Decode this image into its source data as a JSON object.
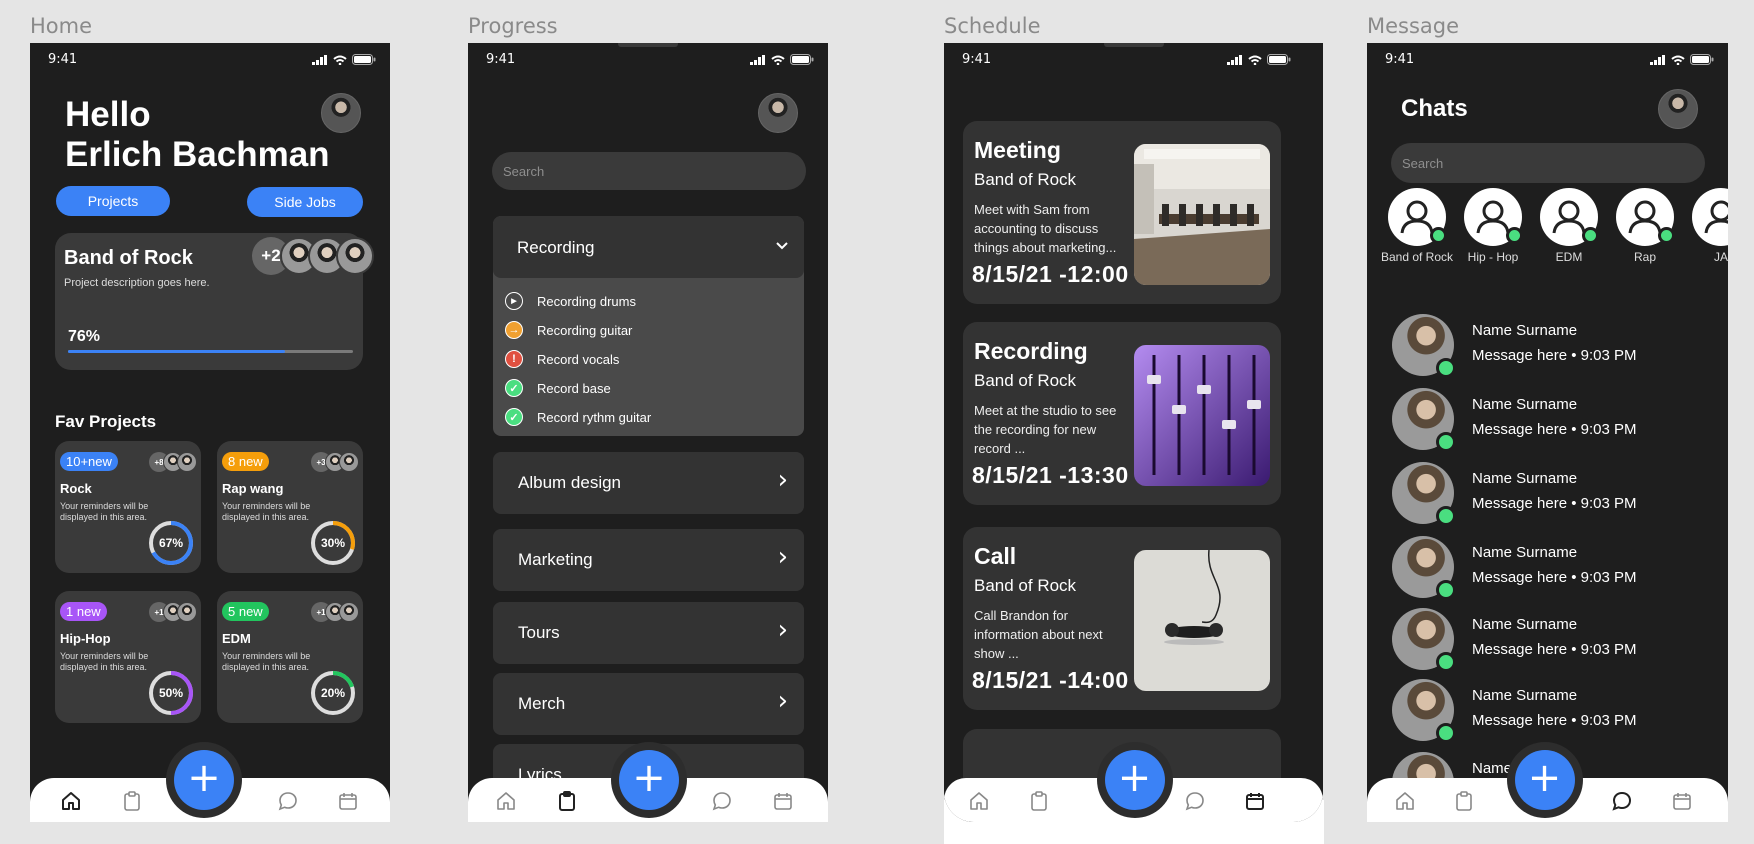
{
  "frames": {
    "home": "Home",
    "progress": "Progress",
    "schedule": "Schedule",
    "message": "Message"
  },
  "status": {
    "time": "9:41"
  },
  "home": {
    "greeting_line1": "Hello",
    "greeting_line2": "Erlich Bachman",
    "projects_button": "Projects",
    "side_jobs_button": "Side Jobs",
    "project_card": {
      "title": "Band of Rock",
      "description": "Project description goes here.",
      "extra_members": "+2",
      "progress_label": "76%",
      "progress": 0.76
    },
    "fav_title": "Fav Projects",
    "fav_projects": [
      {
        "badge": "10+new",
        "badge_color": "#3b82f6",
        "name": "Rock",
        "desc": "Your reminders will be displayed in this area.",
        "extra": "+8",
        "pct_label": "67%",
        "pct": 0.67,
        "ring_color": "#3b82f6"
      },
      {
        "badge": "8 new",
        "badge_color": "#f59e0b",
        "name": "Rap wang",
        "desc": "Your reminders will be displayed in this area.",
        "extra": "+3",
        "pct_label": "30%",
        "pct": 0.3,
        "ring_color": "#f59e0b"
      },
      {
        "badge": "1 new",
        "badge_color": "#a855f7",
        "name": "Hip-Hop",
        "desc": "Your reminders will be displayed in this area.",
        "extra": "+1",
        "pct_label": "50%",
        "pct": 0.5,
        "ring_color": "#a855f7"
      },
      {
        "badge": "5 new",
        "badge_color": "#22c55e",
        "name": "EDM",
        "desc": "Your reminders will be displayed in this area.",
        "extra": "+1",
        "pct_label": "20%",
        "pct": 0.2,
        "ring_color": "#22c55e"
      }
    ]
  },
  "progress": {
    "search_placeholder": "Search",
    "open_section": "Recording",
    "tasks": [
      {
        "label": "Recording drums",
        "status": "play",
        "color": "#ffffff"
      },
      {
        "label": "Recording guitar",
        "status": "in-progress",
        "color": "#f0a030"
      },
      {
        "label": "Record vocals",
        "status": "alert",
        "color": "#e05040"
      },
      {
        "label": "Record base",
        "status": "done",
        "color": "#4ade80"
      },
      {
        "label": "Record rythm guitar",
        "status": "done",
        "color": "#4ade80"
      }
    ],
    "sections": [
      "Album design",
      "Marketing",
      "Tours",
      "Merch",
      "Lyrics"
    ]
  },
  "schedule": {
    "events": [
      {
        "title": "Meeting",
        "project": "Band of Rock",
        "desc": "Meet with Sam from accounting to discuss things about marketing...",
        "datetime": "8/15/21 -12:00",
        "image": "conference-room"
      },
      {
        "title": "Recording",
        "project": "Band of Rock",
        "desc": "Meet at the studio to see the  recording for new record ...",
        "datetime": "8/15/21 -13:30",
        "image": "mixing-console"
      },
      {
        "title": "Call",
        "project": "Band of Rock",
        "desc": "Call Brandon for information about next show ...",
        "datetime": "8/15/21 -14:00",
        "image": "telephone"
      }
    ]
  },
  "message": {
    "title": "Chats",
    "search_placeholder": "Search",
    "groups": [
      {
        "name": "Band of Rock"
      },
      {
        "name": "Hip - Hop"
      },
      {
        "name": "EDM"
      },
      {
        "name": "Rap"
      },
      {
        "name": "JA"
      }
    ],
    "chats": [
      {
        "name": "Name Surname",
        "message": "Message here • 9:03 PM"
      },
      {
        "name": "Name Surname",
        "message": "Message here • 9:03 PM"
      },
      {
        "name": "Name Surname",
        "message": "Message here • 9:03 PM"
      },
      {
        "name": "Name Surname",
        "message": "Message here • 9:03 PM"
      },
      {
        "name": "Name Surname",
        "message": "Message here • 9:03 PM"
      },
      {
        "name": "Name Surname",
        "message": "Message here • 9:03 PM"
      },
      {
        "name": "Name S"
      }
    ]
  },
  "fab_label": "+"
}
